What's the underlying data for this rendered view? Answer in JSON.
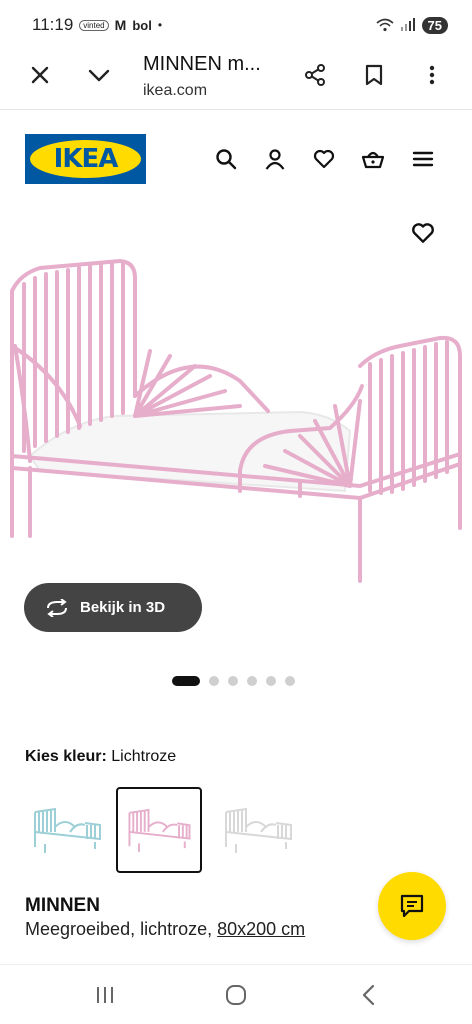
{
  "status_bar": {
    "time": "11:19",
    "app_badges": [
      "vinted",
      "M",
      "bol"
    ],
    "dot": "•",
    "battery": "75"
  },
  "browser": {
    "title": "MINNEN m...",
    "url": "ikea.com"
  },
  "ikea": {
    "logo_text": "IKEA",
    "header_icons": [
      "search-icon",
      "profile-icon",
      "heart-icon",
      "basket-icon",
      "menu-icon"
    ]
  },
  "product": {
    "view_3d_label": "Bekijk in 3D",
    "carousel": {
      "count": 6,
      "active_index": 0
    },
    "colour_label": "Kies kleur:",
    "colour_value": "Lichtroze",
    "swatches": [
      {
        "colour": "light blue",
        "selected": false
      },
      {
        "colour": "light pink",
        "selected": true
      },
      {
        "colour": "white",
        "selected": false
      }
    ],
    "name": "MINNEN",
    "description": "Meegroeibed, lichtroze,",
    "size": "80x200 cm"
  },
  "colors": {
    "ikea_blue": "#0058a3",
    "ikea_yellow": "#ffdb00",
    "bed_pink": "#e9b6cf",
    "button_dark": "#444444"
  }
}
